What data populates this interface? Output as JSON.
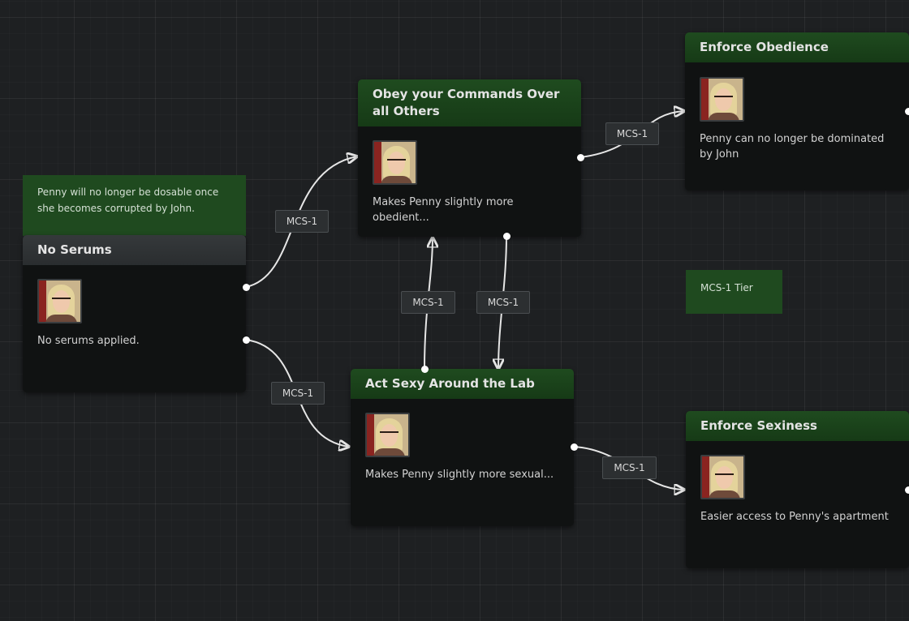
{
  "nodes": {
    "no_serums": {
      "title": "No Serums",
      "description": "No serums applied.",
      "portrait": "penny-portrait"
    },
    "obey_commands": {
      "title": "Obey your Commands Over all Others",
      "description": "Makes Penny slightly more obedient...",
      "portrait": "penny-portrait"
    },
    "enforce_obedience": {
      "title": "Enforce Obedience",
      "description": "Penny can no longer be dominated by John",
      "portrait": "penny-portrait"
    },
    "act_sexy": {
      "title": "Act Sexy Around the Lab",
      "description": "Makes Penny slightly more sexual...",
      "portrait": "penny-portrait"
    },
    "enforce_sexiness": {
      "title": "Enforce Sexiness",
      "description": "Easier access to Penny's apartment",
      "portrait": "penny-portrait"
    }
  },
  "notes": {
    "dosable_note": "Penny will no longer be dosable once she becomes corrupted by John.",
    "tier_note": "MCS-1 Tier"
  },
  "edges": [
    {
      "from": "No Serums",
      "to": "Obey your Commands Over all Others",
      "label": "MCS-1"
    },
    {
      "from": "No Serums",
      "to": "Act Sexy Around the Lab",
      "label": "MCS-1"
    },
    {
      "from": "Act Sexy Around the Lab",
      "to": "Obey your Commands Over all Others",
      "label": "MCS-1"
    },
    {
      "from": "Obey your Commands Over all Others",
      "to": "Act Sexy Around the Lab",
      "label": "MCS-1"
    },
    {
      "from": "Obey your Commands Over all Others",
      "to": "Enforce Obedience",
      "label": "MCS-1"
    },
    {
      "from": "Act Sexy Around the Lab",
      "to": "Enforce Sexiness",
      "label": "MCS-1"
    }
  ],
  "colors": {
    "background": "#1e2022",
    "node_header_green": "#1f4b1f",
    "node_header_gray": "#35393b",
    "node_body": "#101212",
    "note_green": "#1f4a1f",
    "edge_line": "#e6e6e6"
  }
}
